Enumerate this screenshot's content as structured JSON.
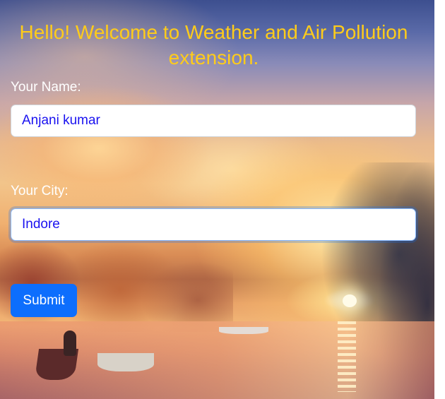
{
  "popup": {
    "welcome_message": "Hello! Welcome to Weather and Air Pollution extension."
  },
  "form": {
    "name_label": "Your Name:",
    "name_value": "Anjani kumar",
    "city_label": "Your City:",
    "city_value": "Indore",
    "submit_label": "Submit"
  },
  "colors": {
    "heading": "#ffcc1a",
    "input_text": "#1a12f0",
    "submit_button": "#0d6efd"
  }
}
